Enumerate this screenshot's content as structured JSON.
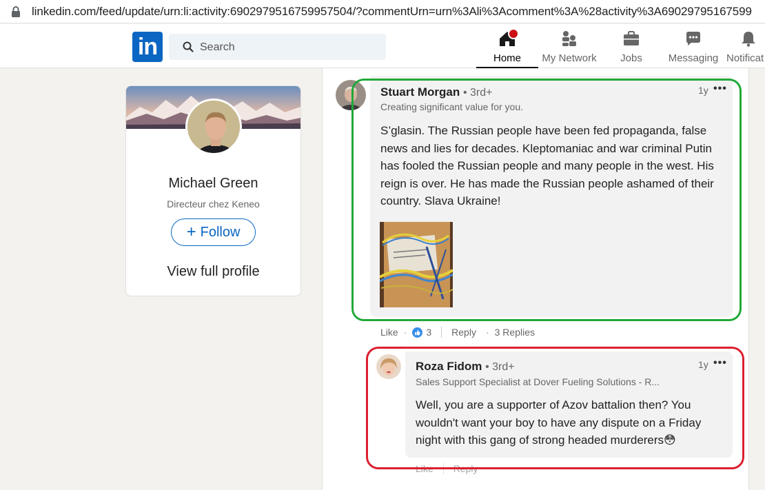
{
  "browser": {
    "url": "linkedin.com/feed/update/urn:li:activity:6902979516759957504/?commentUrn=urn%3Ali%3Acomment%3A%28activity%3A69029795167599"
  },
  "nav": {
    "logo": "in",
    "search_placeholder": "Search",
    "items": [
      {
        "label": "Home"
      },
      {
        "label": "My Network"
      },
      {
        "label": "Jobs"
      },
      {
        "label": "Messaging"
      },
      {
        "label": "Notificat"
      }
    ]
  },
  "profile_card": {
    "name": "Michael Green",
    "title": "Directeur chez Keneo",
    "follow_label": "Follow",
    "view_profile": "View full profile"
  },
  "comment": {
    "author": "Stuart Morgan",
    "degree": "• 3rd+",
    "headline": "Creating significant value for you.",
    "time": "1y",
    "more": "•••",
    "text": "S’glasin. The Russian people have been fed propaganda, false news and lies for decades. Kleptomaniac and war criminal Putin has fooled the Russian people and many people in the west. His reign is over. He has made the Russian people ashamed of their country. Slava Ukraine!",
    "actions": {
      "like": "Like",
      "dot": "·",
      "like_count": "3",
      "reply": "Reply",
      "replies": "3 Replies"
    }
  },
  "reply": {
    "author": "Roza Fidom",
    "degree": "• 3rd+",
    "headline": "Sales Support Specialist at Dover Fueling Solutions - R...",
    "time": "1y",
    "more": "•••",
    "text": "Well, you are a supporter of Azov battalion then? You wouldn't want your boy to have any dispute on a Friday night with this gang of strong headed murderers",
    "emoji": "😳",
    "actions": {
      "like": "Like",
      "reply": "Reply"
    }
  },
  "colors": {
    "brand": "#0a66c2",
    "highlight_green": "#22a838",
    "highlight_red": "#dd1e2f",
    "badge": "#cc1016"
  }
}
